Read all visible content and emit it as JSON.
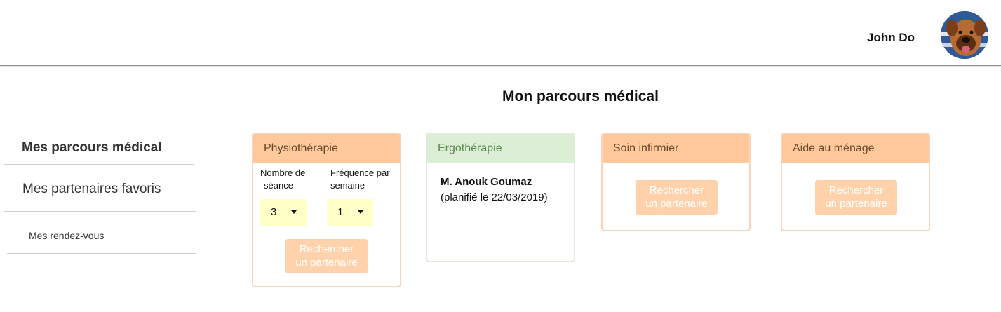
{
  "header": {
    "username": "John Do",
    "avatar_icon": "dog-avatar-icon"
  },
  "page": {
    "title": "Mon parcours médical"
  },
  "sidebar": {
    "items": [
      {
        "label": "Mes parcours médical"
      },
      {
        "label": "Mes partenaires favoris"
      },
      {
        "label": "Mes rendez-vous"
      }
    ]
  },
  "cards": [
    {
      "title": "Physiothérapie",
      "seance_label_line1": "Nombre de",
      "seance_label_line2": "séance",
      "seance_value": "3",
      "frequence_label_line1": "Fréquence par",
      "frequence_label_line2": "semaine",
      "frequence_value": "1",
      "button_line1": "Rechercher",
      "button_line2": "un partenaire"
    },
    {
      "title": "Ergothérapie",
      "partner_name": "M. Anouk Goumaz",
      "partner_date": "(planifié le 22/03/2019)"
    },
    {
      "title": "Soin infirmier",
      "button_line1": "Rechercher",
      "button_line2": "un partenaire"
    },
    {
      "title": "Aide au ménage",
      "button_line1": "Rechercher",
      "button_line2": "un partenaire"
    }
  ],
  "colors": {
    "orange_header": "#ffc99b",
    "green_header": "#dcefd6",
    "button": "#ffd2ac",
    "select_bg": "#ffffc8"
  }
}
